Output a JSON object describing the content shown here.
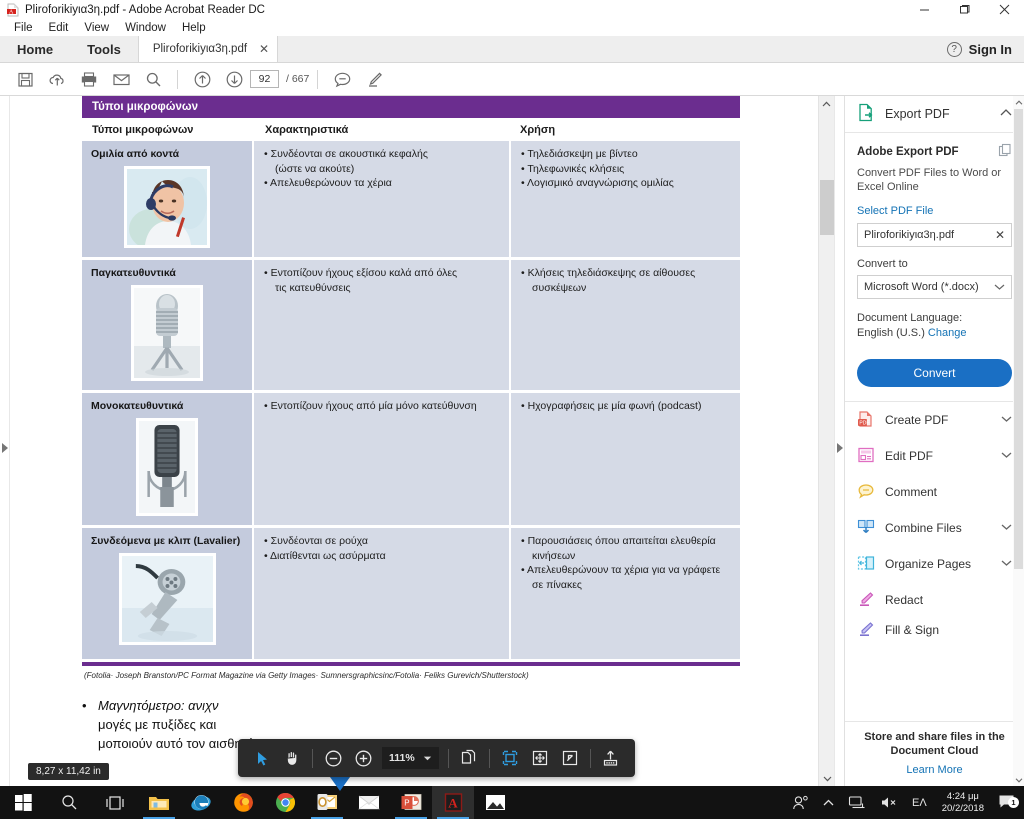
{
  "window": {
    "title": "Pliroforikiyια3η.pdf - Adobe Acrobat Reader DC",
    "app_icon": "acrobat-icon",
    "minimize": "–",
    "maximize": "❐",
    "close": "✕"
  },
  "menubar": {
    "items": [
      "File",
      "Edit",
      "View",
      "Window",
      "Help"
    ]
  },
  "tabstrip": {
    "home_label": "Home",
    "tools_label": "Tools",
    "doc_tab_label": "Pliroforikiyια3η.pdf",
    "doc_tab_close": "✕",
    "help_label": "?",
    "signin_label": "Sign In"
  },
  "toolbar": {
    "icons": [
      "save-icon",
      "upload-cloud-icon",
      "print-icon",
      "email-icon",
      "search-icon"
    ],
    "page_up": "↑",
    "page_down": "↓",
    "page_current": "92",
    "page_total": "/ 667",
    "comment_icon": "comment-icon",
    "highlight_icon": "highlight-pen-icon"
  },
  "document": {
    "banner": "Τύποι μικροφώνων",
    "columns": [
      "Τύποι μικροφώνων",
      "Χαρακτηριστικά",
      "Χρήση"
    ],
    "rows": [
      {
        "name": "Ομιλία από κοντά",
        "image": "headset-woman-photo",
        "features": [
          "Συνδέονται σε ακουστικά κεφαλής",
          "(ώστε να ακούτε)",
          "Απελευθερώνουν τα χέρια"
        ],
        "feature_bullets": [
          true,
          false,
          true
        ],
        "uses": [
          "Τηλεδιάσκεψη με βίντεο",
          "Τηλεφωνικές κλήσεις",
          "Λογισμικό αναγνώρισης ομιλίας"
        ],
        "use_bullets": [
          true,
          true,
          true
        ]
      },
      {
        "name": "Παγκατευθυντικά",
        "image": "omnidirectional-microphone-photo",
        "features": [
          "Εντοπίζουν ήχους εξίσου καλά από όλες",
          "τις κατευθύνσεις"
        ],
        "feature_bullets": [
          true,
          false
        ],
        "uses": [
          "Κλήσεις τηλεδιάσκεψης σε αίθουσες",
          "συσκέψεων"
        ],
        "use_bullets": [
          true,
          false
        ]
      },
      {
        "name": "Μονοκατευθυντικά",
        "image": "unidirectional-microphone-photo",
        "features": [
          "Εντοπίζουν ήχους από μία μόνο κατεύθυνση"
        ],
        "feature_bullets": [
          true
        ],
        "uses": [
          "Ηχογραφήσεις με μία φωνή (podcast)"
        ],
        "use_bullets": [
          true
        ]
      },
      {
        "name": "Συνδεόμενα με κλιπ (Lavalier)",
        "image": "lavalier-microphone-photo",
        "features": [
          "Συνδέονται σε ρούχα",
          "Διατίθενται ως ασύρματα"
        ],
        "feature_bullets": [
          true,
          true
        ],
        "uses": [
          "Παρουσιάσεις όπου απαιτείται ελευθερία",
          "κινήσεων",
          "Απελευθερώνουν τα χέρια για να γράφετε",
          "σε πίνακες"
        ],
        "use_bullets": [
          true,
          false,
          true,
          false
        ]
      }
    ],
    "credit": "(Fotolia· Joseph Branston/PC Format Magazine via Getty Images· Sumnersgraphicsinc/Fotolia· Feliks Gurevich/Shutterstock)",
    "body_bullet": "•",
    "body_lines": [
      "Μαγνητόμετρο: ανιχν",
      "μογές με πυξίδες και ",
      "μοποιούν αυτό τον αισθητήρα."
    ],
    "page_size_tooltip": "8,27 x 11,42 in"
  },
  "floating_toolbar": {
    "select_icon": "cursor-select-icon",
    "hand_icon": "hand-pan-icon",
    "zoom_out": "⊖",
    "zoom_in": "⊕",
    "zoom_value": "111%",
    "zoom_caret": "▾",
    "copy_icon": "copy-pages-icon",
    "fit_icon": "fit-page-icon",
    "move_icon": "move-page-icon",
    "expand_icon": "expand-icon",
    "share_icon": "share-upload-icon"
  },
  "right_panel": {
    "header_title": "Export PDF",
    "header_icon": "export-pdf-icon",
    "header_chevron": "⌃",
    "section_title": "Adobe Export PDF",
    "section_copy_icon": "duplicate-icon",
    "description": "Convert PDF Files to Word or Excel Online",
    "select_file_label": "Select PDF File",
    "selected_file": "Pliroforikiyια3η.pdf",
    "clear_file": "✕",
    "convert_to_label": "Convert to",
    "convert_to_value": "Microsoft Word (*.docx)",
    "convert_caret": "⌄",
    "doc_language_label": "Document Language:",
    "doc_language_value": "English (U.S.)",
    "doc_language_change": "Change",
    "convert_button": "Convert",
    "tools": [
      {
        "label": "Create PDF",
        "icon": "create-pdf-icon",
        "chevron": "⌄"
      },
      {
        "label": "Edit PDF",
        "icon": "edit-pdf-icon",
        "chevron": "⌄"
      },
      {
        "label": "Comment",
        "icon": "comment-bubble-icon",
        "chevron": ""
      },
      {
        "label": "Combine Files",
        "icon": "combine-files-icon",
        "chevron": "⌄"
      },
      {
        "label": "Organize Pages",
        "icon": "organize-pages-icon",
        "chevron": "⌄"
      },
      {
        "label": "Redact",
        "icon": "redact-icon",
        "chevron": ""
      },
      {
        "label": "Fill & Sign",
        "icon": "fill-sign-icon",
        "chevron": ""
      }
    ],
    "footer_line1": "Store and share files in the",
    "footer_line2": "Document Cloud",
    "footer_link": "Learn More"
  },
  "taskbar": {
    "start_icon": "windows-start-icon",
    "search_icon": "search-icon",
    "taskview_icon": "task-view-icon",
    "apps": [
      {
        "name": "file-explorer-icon",
        "active": false,
        "running": true
      },
      {
        "name": "internet-explorer-icon",
        "active": false,
        "running": false
      },
      {
        "name": "firefox-icon",
        "active": false,
        "running": true
      },
      {
        "name": "chrome-icon",
        "active": false,
        "running": false
      },
      {
        "name": "outlook-icon",
        "active": false,
        "running": true
      },
      {
        "name": "mail-icon",
        "active": false,
        "running": false
      },
      {
        "name": "powerpoint-icon",
        "active": false,
        "running": true
      },
      {
        "name": "adobe-reader-icon",
        "active": true,
        "running": true
      },
      {
        "name": "photos-icon",
        "active": false,
        "running": false
      }
    ],
    "tray": {
      "people_icon": "people-icon",
      "show_hidden_icon": "⌃",
      "network_icon": "network-icon",
      "volume_icon": "volume-muted-icon",
      "language": "EΛ",
      "time": "4:24 μμ",
      "date": "20/2/2018",
      "action_center_icon": "action-center-icon",
      "notification_count": "1"
    }
  },
  "colors": {
    "banner_purple": "#6b2d8f",
    "cell_light": "#d5dae6",
    "cell_dark": "#c4cbdd",
    "accent_blue": "#1a6fc4",
    "link_blue": "#1473b5",
    "taskbar_bg": "#121212"
  }
}
